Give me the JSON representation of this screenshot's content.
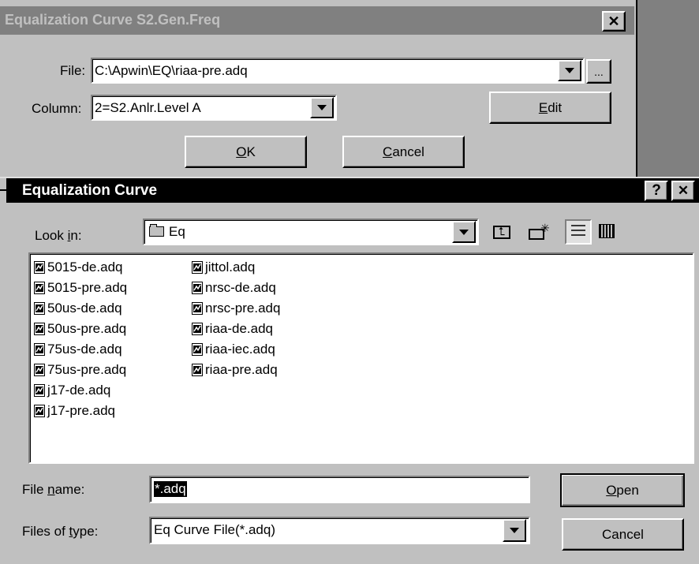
{
  "parent_dialog": {
    "title": "Equalization Curve S2.Gen.Freq",
    "file_label": "File:",
    "file_value": "C:\\Apwin\\EQ\\riaa-pre.adq",
    "browse_label": "...",
    "column_label": "Column:",
    "column_value": "2=S2.Anlr.Level A",
    "edit_label": "Edit",
    "edit_mnemonic": "E",
    "edit_rest": "dit",
    "ok_mnemonic": "O",
    "ok_rest": "K",
    "cancel_mnemonic": "C",
    "cancel_rest": "ancel"
  },
  "open_dialog": {
    "title": "Equalization Curve",
    "help_label": "?",
    "close_label": "✕",
    "lookin_prefix": "Look ",
    "lookin_mnemonic": "i",
    "lookin_suffix": "n:",
    "lookin_value": "Eq",
    "files_col1": [
      "5015-de.adq",
      "5015-pre.adq",
      "50us-de.adq",
      "50us-pre.adq",
      "75us-de.adq",
      "75us-pre.adq",
      "j17-de.adq",
      "j17-pre.adq"
    ],
    "files_col2": [
      "jittol.adq",
      "nrsc-de.adq",
      "nrsc-pre.adq",
      "riaa-de.adq",
      "riaa-iec.adq",
      "riaa-pre.adq"
    ],
    "filename_prefix": "File ",
    "filename_mnemonic": "n",
    "filename_suffix": "ame:",
    "filename_value": "*.adq",
    "filetype_prefix": "Files of ",
    "filetype_mnemonic": "t",
    "filetype_suffix": "ype:",
    "filetype_value": "Eq Curve File(*.adq)",
    "open_mnemonic": "O",
    "open_rest": "pen",
    "cancel_label": "Cancel"
  },
  "colors": {
    "inactive_title_bg": "#808080",
    "inactive_title_fg": "#c0c0c0",
    "active_title_bg": "#000000",
    "active_title_fg": "#ffffff",
    "face": "#c0c0c0"
  }
}
